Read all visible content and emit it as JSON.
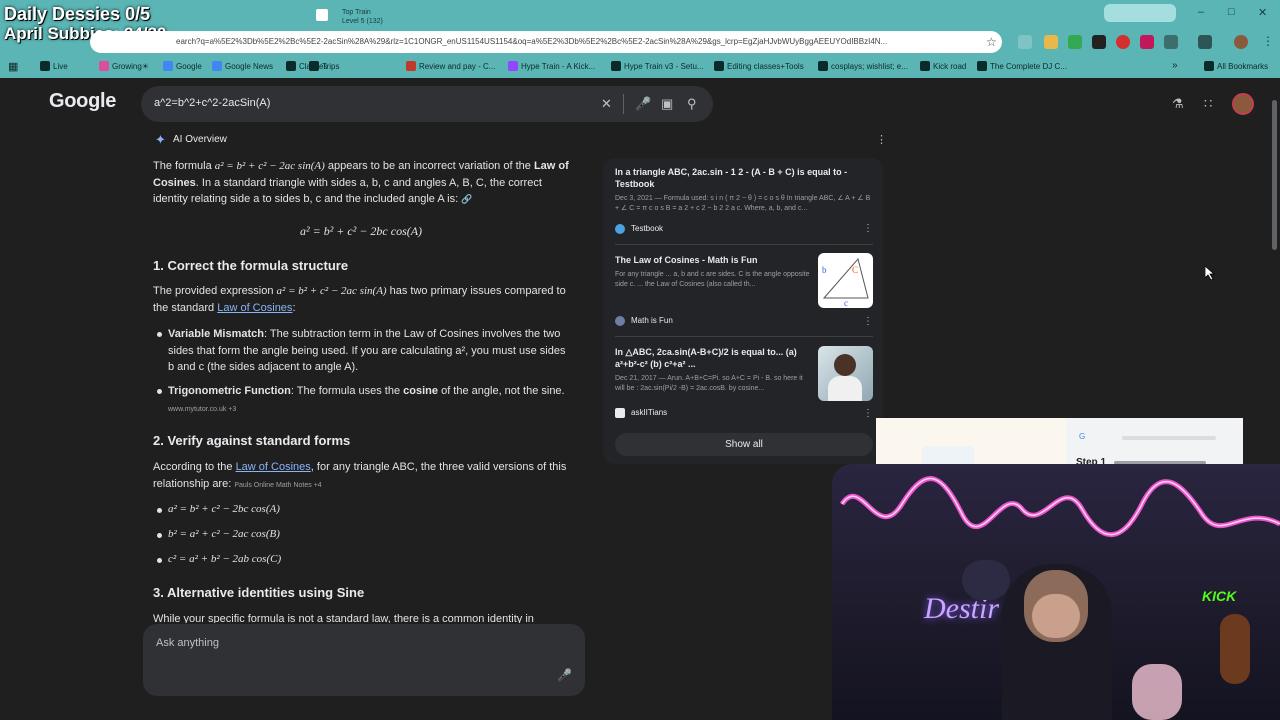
{
  "stream": {
    "line1": "Daily Dessies 0/5",
    "line2": "April Subbies: 24/30"
  },
  "browser": {
    "tabs": [
      {
        "title": "Top Train",
        "subtitle": "Level 5 (132)"
      }
    ],
    "url": "earch?q=a%5E2%3Db%5E2%2Bc%5E2-2acSin%28A%29&rlz=1C1ONGR_enUS1154US1154&oq=a%5E2%3Db%5E2%2Bc%5E2-2acSin%28A%29&gs_lcrp=EgZjaHJvbWUyBggAEEUYOdIBBzI4N...",
    "bookmarks": [
      {
        "label": "Live",
        "color": "#0d2a2a"
      },
      {
        "label": "Growing☀",
        "color": "#d94f9b"
      },
      {
        "label": "Google",
        "color": "#4285f4"
      },
      {
        "label": "Google News",
        "color": "#4285f4"
      },
      {
        "label": "Classes",
        "color": "#0d2a2a"
      },
      {
        "label": "Trips",
        "color": "#0d2a2a"
      },
      {
        "label": "Review and pay - C...",
        "color": "#c0392b"
      },
      {
        "label": "Hype Train - A Kick...",
        "color": "#9146ff"
      },
      {
        "label": "Hype Train v3 - Setu...",
        "color": "#0d2a2a"
      },
      {
        "label": "Editing classes+Tools",
        "color": "#0d2a2a"
      },
      {
        "label": "cosplays; wishlist; e...",
        "color": "#0d2a2a"
      },
      {
        "label": "Kick road",
        "color": "#0d2a2a"
      },
      {
        "label": "The Complete DJ C...",
        "color": "#0d2a2a"
      }
    ],
    "all_bookmarks": "All Bookmarks"
  },
  "google": {
    "logo": "Google",
    "query": "a^2=b^2+c^2-2acSin(A)",
    "ai_overview_label": "AI Overview",
    "intro_1a": "The formula ",
    "intro_formula": "a² = b² + c² − 2ac sin(A)",
    "intro_1b": " appears to be an incorrect variation of the ",
    "intro_bold": "Law of Cosines",
    "intro_2": ". In a standard triangle with sides a, b, c and angles A, B, C, the correct identity relating side a to sides b, c and the included angle A is:",
    "main_formula": "a² = b² + c² − 2bc cos(A)",
    "section1_title": "1. Correct the formula structure",
    "section1_text_a": "The provided expression ",
    "section1_formula": "a² = b² + c² − 2ac sin(A)",
    "section1_text_b": " has two primary issues compared to the standard ",
    "law_link": "Law of Cosines",
    "bullet1_bold": "Variable Mismatch",
    "bullet1_text": ": The subtraction term in the Law of Cosines involves the two sides that form the angle being used. If you are calculating a², you must use sides b and c (the sides adjacent to angle A).",
    "bullet2_bold": "Trigonometric Function",
    "bullet2_text_a": ": The formula uses the ",
    "bullet2_bold2": "cosine",
    "bullet2_text_b": " of the angle, not the sine.",
    "bullet2_source": "www.mytutor.co.uk +3",
    "section2_title": "2. Verify against standard forms",
    "section2_text_a": "According to the ",
    "section2_link": "Law of Cosines",
    "section2_text_b": ", for any triangle ABC, the three valid versions of this relationship are:",
    "section2_source": "Pauls Online Math Notes +4",
    "forms": [
      "a² = b² + c² − 2bc cos(A)",
      "b² = a² + c² − 2ac cos(B)",
      "c² = a² + b² − 2ab cos(C)"
    ],
    "section3_title": "3. Alternative identities using Sine",
    "section3_text": "While your specific formula is not a standard law, there is a common identity in",
    "ask_placeholder": "Ask anything",
    "sources": [
      {
        "title": "In a triangle ABC, 2ac.sin - 1 2 - (A - B + C) is equal to - Testbook",
        "snippet": "Dec 3, 2021 — Formula used: s i n ( π 2 − θ ) = c o s θ In triangle ABC, ∠ A + ∠ B + ∠ C = π c o s B = a 2 + c 2 − b 2 2 a c. Where, a, b, and c...",
        "site": "Testbook"
      },
      {
        "title": "The Law of Cosines - Math is Fun",
        "snippet": "For any triangle ... a, b and c are sides. C is the angle opposite side c. ... the Law of Cosines (also called th...",
        "site": "Math is Fun"
      },
      {
        "title": "In △ABC, 2ca.sin(A-B+C)/2 is equal to... (a) a²+b²-c² (b) c²+a² ...",
        "snippet": "Dec 21, 2017 — Arun. A+B+C=Pi. so A+C = Pi - B. so here it will be : 2ac.sin(Pi/2 -B) = 2ac.cosB. by cosine...",
        "site": "askIITians"
      }
    ],
    "show_all": "Show all"
  },
  "overlay": {
    "step": "Step 1"
  },
  "webcam": {
    "neon_text": "Destir",
    "kick_text": "KICK"
  }
}
